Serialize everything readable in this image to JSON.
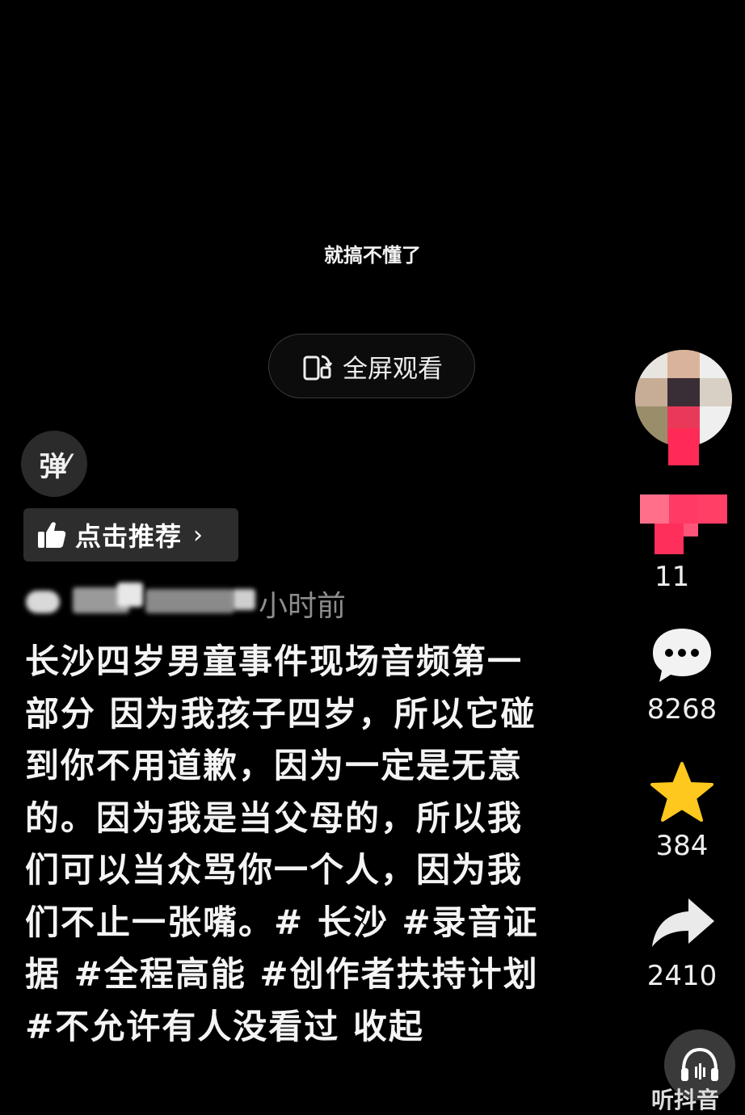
{
  "video": {
    "subtitle": "就搞不懂了",
    "fullscreen_label": "全屏观看"
  },
  "controls": {
    "danmu_label": "弹",
    "recommend_label": "点击推荐"
  },
  "post": {
    "time_ago": "小时前",
    "caption": "长沙四岁男童事件现场音频第一部分 因为我孩子四岁，所以它碰到你不用道歉，因为一定是无意的。因为我是当父母的，所以我们可以当众骂你一个人，因为我们不止一张嘴。# 长沙 #录音证据 #全程高能 #创作者扶持计划 #不允许有人没看过",
    "collapse_label": "收起"
  },
  "sidebar": {
    "likes": "11",
    "comments": "8268",
    "favorites": "384",
    "shares": "2410",
    "listen_label": "听抖音"
  },
  "colors": {
    "background": "#000000",
    "accent_pink": "#ff2a55",
    "star": "#ffc81e"
  }
}
